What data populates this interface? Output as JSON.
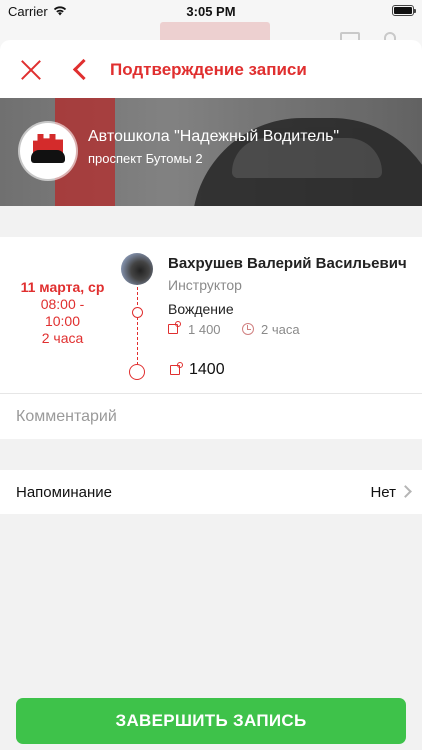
{
  "status_bar": {
    "carrier": "Carrier",
    "time": "3:05 PM"
  },
  "nav": {
    "title": "Подтверждение записи",
    "close_icon": "close-icon",
    "back_icon": "chevron-left-icon"
  },
  "school": {
    "name": "Автошкола \"Надежный Водитель\"",
    "address": "проспект Бутомы 2"
  },
  "booking": {
    "date_day": "11 марта, ср",
    "time_start": "08:00 -",
    "time_end": "10:00",
    "duration": "2 часа",
    "instructor_name": "Вахрушев Валерий Васильевич",
    "instructor_role": "Инструктор",
    "service_name": "Вождение",
    "service_price": "1 400",
    "service_duration": "2 часа",
    "total_price": "1400"
  },
  "comment": {
    "placeholder": "Комментарий",
    "value": ""
  },
  "reminder": {
    "label": "Напоминание",
    "value": "Нет"
  },
  "actions": {
    "finish_label": "ЗАВЕРШИТЬ ЗАПИСЬ"
  },
  "colors": {
    "accent": "#e02f2f",
    "primary_button": "#3ec24a",
    "background": "#f2f2f2"
  }
}
